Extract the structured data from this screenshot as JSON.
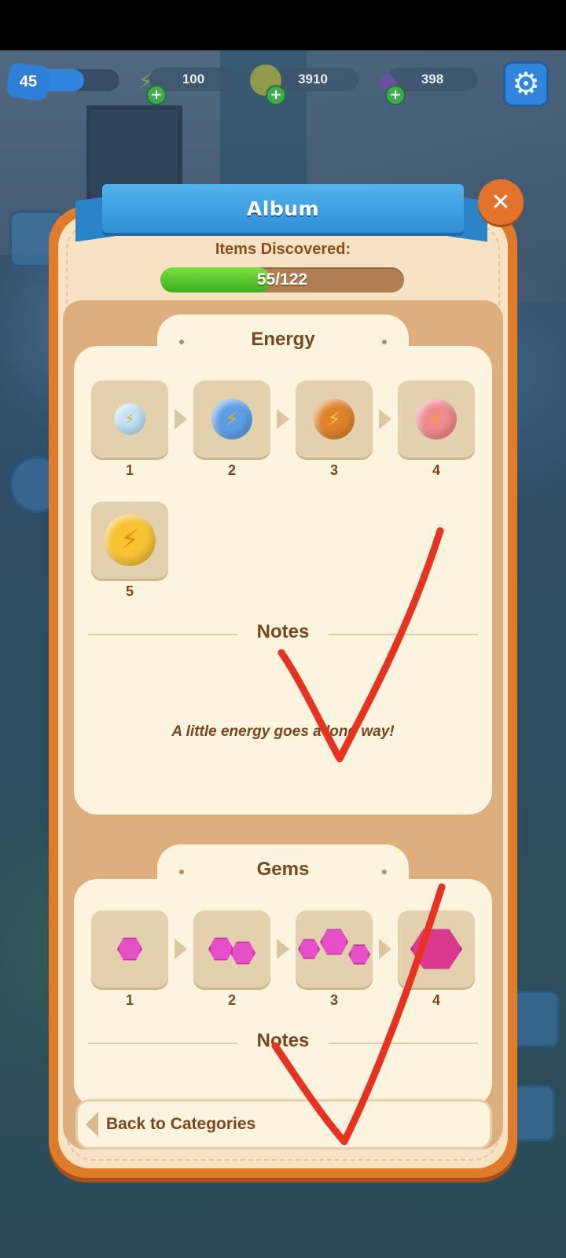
{
  "hud": {
    "level": "45",
    "energy": "100",
    "coins": "3910",
    "gems": "398"
  },
  "album": {
    "title": "Album",
    "discovered_label": "Items Discovered:",
    "discovered_count": "55/122",
    "discovered_fraction": 0.45
  },
  "energy_section": {
    "title": "Energy",
    "items": [
      {
        "level": "1",
        "color": "#bfe3f7"
      },
      {
        "level": "2",
        "color": "#5c9fe6"
      },
      {
        "level": "3",
        "color": "#e0832a"
      },
      {
        "level": "4",
        "color": "#f08a8e"
      },
      {
        "level": "5",
        "color": "#f7c335"
      }
    ],
    "notes_title": "Notes",
    "notes_text": "A little energy goes a long way!"
  },
  "gems_section": {
    "title": "Gems",
    "items": [
      {
        "level": "1"
      },
      {
        "level": "2"
      },
      {
        "level": "3"
      },
      {
        "level": "4"
      }
    ],
    "notes_title": "Notes"
  },
  "footer": {
    "back_label": "Back to Categories"
  },
  "colors": {
    "panel_orange": "#e07b2a",
    "ribbon_blue": "#2f8fd6",
    "progress_green": "#3aae1e",
    "text_brown": "#7a4620",
    "checkmark_red": "#e8321f"
  }
}
